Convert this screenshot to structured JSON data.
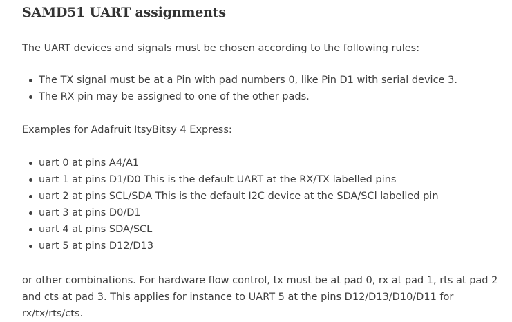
{
  "section": {
    "title": "SAMD51 UART assignments",
    "intro": "The UART devices and signals must be chosen according to the following rules:",
    "rules": [
      "The TX signal must be at a Pin with pad numbers 0, like Pin D1 with serial device 3.",
      "The RX pin may be assigned to one of the other pads."
    ],
    "examples_heading": "Examples for Adafruit ItsyBitsy 4 Express:",
    "examples": [
      "uart 0 at pins A4/A1",
      "uart 1 at pins D1/D0 This is the default UART at the RX/TX labelled pins",
      "uart 2 at pins SCL/SDA This is the default I2C device at the SDA/SCl labelled pin",
      "uart 3 at pins D0/D1",
      "uart 4 at pins SDA/SCL",
      "uart 5 at pins D12/D13"
    ],
    "outro": "or other combinations. For hardware flow control, tx must be at pad 0, rx at pad 1, rts at pad 2 and cts at pad 3. This applies for instance to UART 5 at the pins D12/D13/D10/D11 for rx/tx/rts/cts."
  }
}
